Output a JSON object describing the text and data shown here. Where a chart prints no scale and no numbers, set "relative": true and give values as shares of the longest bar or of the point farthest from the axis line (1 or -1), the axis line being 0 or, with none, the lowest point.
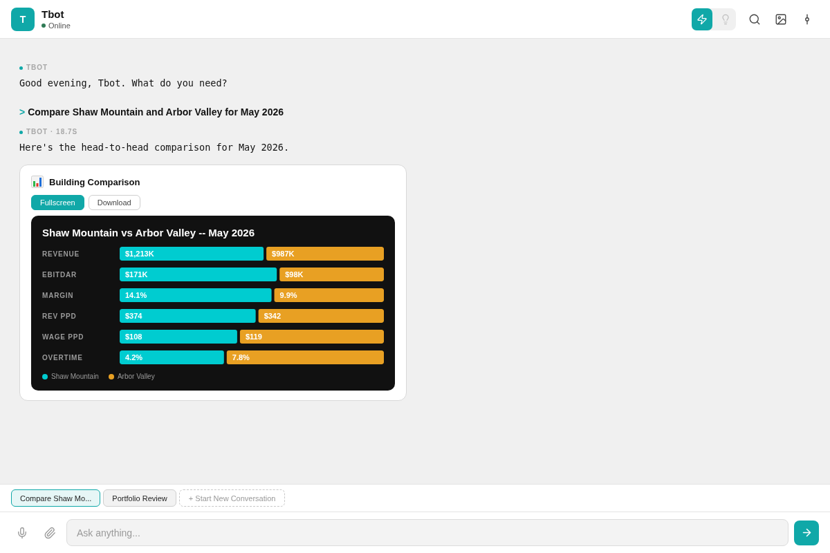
{
  "header": {
    "avatar": "T",
    "name": "Tbot",
    "status": "Online",
    "online": true,
    "modes": [
      {
        "kind": "bolt",
        "selected": true
      },
      {
        "kind": "bulb",
        "selected": false
      }
    ]
  },
  "messages": [
    {
      "kind": "bot",
      "label": "TBOT",
      "text": "Good evening, Tbot. What do you need?"
    },
    {
      "kind": "user",
      "marker": ">",
      "text": "Compare Shaw Mountain and Arbor Valley for May 2026"
    },
    {
      "kind": "bot",
      "label": "TBOT · 18.7S",
      "text": "Here's the head-to-head comparison for May 2026.",
      "card": {
        "title": "Building Comparison",
        "buttons": [
          {
            "label": "Fullscreen",
            "kind": "primary"
          },
          {
            "label": "Download",
            "kind": "secondary"
          }
        ],
        "bar_labels": [
          [
            "$1,213K",
            "$171K",
            "14.1%",
            "$374",
            "$108",
            "4.2%"
          ],
          [
            "$987K",
            "$98K",
            "9.9%",
            "$342",
            "$119",
            "7.8%"
          ]
        ],
        "chart_data": {
          "type": "bar",
          "orientation": "horizontal",
          "stacked": true,
          "relative": true,
          "title": "Shaw Mountain vs Arbor Valley -- May 2026",
          "categories": [
            "REVENUE",
            "EBITDAR",
            "MARGIN",
            "REV PPD",
            "WAGE PPD",
            "OVERTIME"
          ],
          "legend": "bottom-left",
          "series": [
            {
              "name": "Shaw Mountain",
              "color": "#00ccd0",
              "values": [
                0.55,
                0.6,
                0.58,
                0.52,
                0.45,
                0.4
              ]
            },
            {
              "name": "Arbor Valley",
              "color": "#e8a023",
              "values": [
                0.45,
                0.4,
                0.42,
                0.48,
                0.55,
                0.6
              ]
            }
          ]
        }
      }
    }
  ],
  "conversation_tabs": [
    {
      "label": "Compare Shaw Mo...",
      "selected": true
    },
    {
      "label": "Portfolio Review",
      "selected": false
    }
  ],
  "new_conversation": "+ Start New Conversation",
  "composer": {
    "placeholder": "Ask anything..."
  }
}
